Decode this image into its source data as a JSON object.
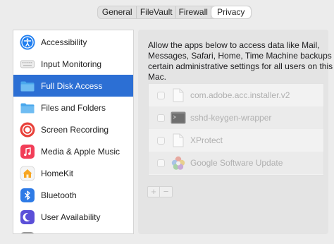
{
  "tabs": [
    {
      "label": "General",
      "active": false
    },
    {
      "label": "FileVault",
      "active": false
    },
    {
      "label": "Firewall",
      "active": false
    },
    {
      "label": "Privacy",
      "active": true
    }
  ],
  "sidebar": {
    "items": [
      {
        "label": "Accessibility",
        "icon": "accessibility-icon",
        "active": false
      },
      {
        "label": "Input Monitoring",
        "icon": "keyboard-icon",
        "active": false
      },
      {
        "label": "Full Disk Access",
        "icon": "folder-icon",
        "active": true
      },
      {
        "label": "Files and Folders",
        "icon": "folder-icon",
        "active": false
      },
      {
        "label": "Screen Recording",
        "icon": "screen-recording-icon",
        "active": false
      },
      {
        "label": "Media & Apple Music",
        "icon": "music-icon",
        "active": false
      },
      {
        "label": "HomeKit",
        "icon": "home-icon",
        "active": false
      },
      {
        "label": "Bluetooth",
        "icon": "bluetooth-icon",
        "active": false
      },
      {
        "label": "User Availability",
        "icon": "moon-icon",
        "active": false
      }
    ]
  },
  "main": {
    "description_lines": [
      "Allow the apps below to access data like Mail,",
      "Messages, Safari, Home, Time Machine backups and",
      "certain administrative settings for all users on this",
      "Mac."
    ],
    "apps": [
      {
        "name": "com.adobe.acc.installer.v2",
        "icon": "document-icon",
        "checked": false
      },
      {
        "name": "sshd-keygen-wrapper",
        "icon": "terminal-icon",
        "checked": false
      },
      {
        "name": "XProtect",
        "icon": "document-icon",
        "checked": false
      },
      {
        "name": "Google Software Update",
        "icon": "google-update-icon",
        "checked": false
      }
    ],
    "add_label": "+",
    "remove_label": "−"
  },
  "colors": {
    "accent": "#2c6fd4",
    "window_bg": "#ececec",
    "panel_bg": "#e4e4e4"
  }
}
